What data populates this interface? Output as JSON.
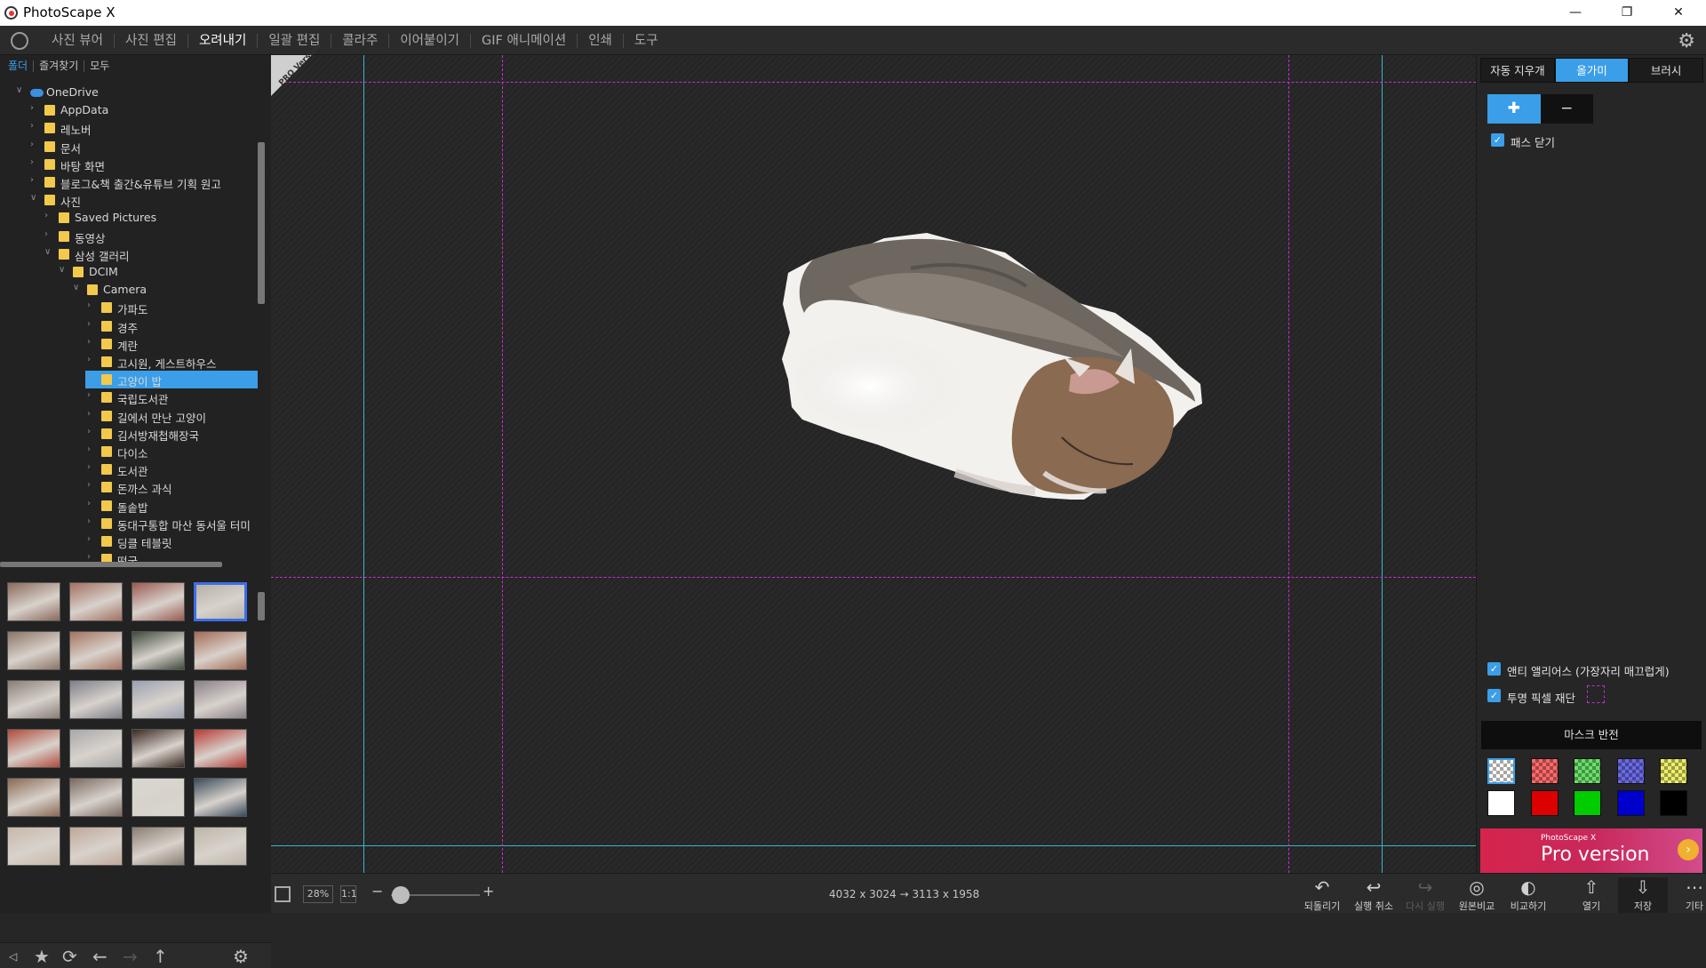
{
  "window": {
    "title": "PhotoScape X"
  },
  "menu": {
    "tabs": [
      "사진 뷰어",
      "사진 편집",
      "오려내기",
      "일괄 편집",
      "콜라주",
      "이어붙이기",
      "GIF 애니메이션",
      "인쇄",
      "도구"
    ],
    "active_tab": "오려내기"
  },
  "left_panel": {
    "tabs": [
      "폴더",
      "즐겨찾기",
      "모두"
    ],
    "tree": [
      {
        "label": "OneDrive",
        "depth": 0,
        "expanded": true,
        "icon": "cloud-icon"
      },
      {
        "label": "AppData",
        "depth": 1,
        "expanded": false
      },
      {
        "label": "레노버",
        "depth": 1,
        "expanded": false
      },
      {
        "label": "문서",
        "depth": 1,
        "expanded": false
      },
      {
        "label": "바탕 화면",
        "depth": 1,
        "expanded": false
      },
      {
        "label": "블로그&책 출간&유튜브 기획 원고",
        "depth": 1,
        "expanded": false
      },
      {
        "label": "사진",
        "depth": 1,
        "expanded": true
      },
      {
        "label": "Saved Pictures",
        "depth": 2,
        "expanded": false
      },
      {
        "label": "동영상",
        "depth": 2,
        "expanded": false
      },
      {
        "label": "삼성 갤러리",
        "depth": 2,
        "expanded": true
      },
      {
        "label": "DCIM",
        "depth": 3,
        "expanded": true
      },
      {
        "label": "Camera",
        "depth": 4,
        "expanded": true
      },
      {
        "label": "가파도",
        "depth": 5,
        "expanded": false
      },
      {
        "label": "경주",
        "depth": 5,
        "expanded": false
      },
      {
        "label": "계란",
        "depth": 5,
        "expanded": false
      },
      {
        "label": "고시원, 게스트하우스",
        "depth": 5,
        "expanded": false
      },
      {
        "label": "고양이 밥",
        "depth": 5,
        "expanded": false,
        "selected": true
      },
      {
        "label": "국립도서관",
        "depth": 5,
        "expanded": false
      },
      {
        "label": "길에서 만난 고양이",
        "depth": 5,
        "expanded": false
      },
      {
        "label": "김서방재첩해장국",
        "depth": 5,
        "expanded": false
      },
      {
        "label": "다이소",
        "depth": 5,
        "expanded": false
      },
      {
        "label": "도서관",
        "depth": 5,
        "expanded": false
      },
      {
        "label": "돈까스 과식",
        "depth": 5,
        "expanded": false
      },
      {
        "label": "돌솥밥",
        "depth": 5,
        "expanded": false
      },
      {
        "label": "동대구통합 마산 동서울 터미",
        "depth": 5,
        "expanded": false
      },
      {
        "label": "딩클 테블릿",
        "depth": 5,
        "expanded": false
      },
      {
        "label": "떡국",
        "depth": 5,
        "expanded": false
      }
    ],
    "thumbnail_colors": [
      [
        "#8a6a5a",
        "#a37060",
        "#9a5a50",
        "#b5b0a8"
      ],
      [
        "#8c7565",
        "#a5735e",
        "#3f4a3c",
        "#a56b55"
      ],
      [
        "#8a7d78",
        "#7d7f8a",
        "#9aa0b0",
        "#8a8088"
      ],
      [
        "#b04a3a",
        "#a8a8a8",
        "#3a2a22",
        "#b83a34"
      ],
      [
        "#8a6a55",
        "#7a6a60",
        "#d8d6d0",
        "#3a4a5a"
      ],
      [
        "#c8b8a8",
        "#c0a898",
        "#8a7e70",
        "#bcb6a8"
      ]
    ],
    "selected_thumbnail": "0-3"
  },
  "canvas": {
    "badge": "PRO Version"
  },
  "status": {
    "zoom": "28%",
    "zoom_1to1": "1:1",
    "zoom_minus": "−",
    "zoom_plus": "+",
    "zoom_level": 0.28,
    "dimensions": "4032 x 3024 → 3113 x 1958"
  },
  "bottom_actions": [
    {
      "label": "되돌리기",
      "icon": "revert-icon",
      "enabled": true
    },
    {
      "label": "실행 취소",
      "icon": "undo-icon",
      "enabled": true
    },
    {
      "label": "다시 실행",
      "icon": "redo-icon",
      "enabled": false
    },
    {
      "label": "원본비교",
      "icon": "compare-original-icon",
      "enabled": true
    },
    {
      "label": "비교하기",
      "icon": "compare-icon",
      "enabled": true
    },
    {
      "label": "열기",
      "icon": "open-icon",
      "enabled": true
    },
    {
      "label": "저장",
      "icon": "save-icon",
      "enabled": true
    },
    {
      "label": "기타",
      "icon": "more-icon",
      "enabled": true
    }
  ],
  "right_panel": {
    "mode_tabs": [
      "자동 지우개",
      "올가미",
      "브러시"
    ],
    "active_mode": "올가미",
    "close_path": {
      "label": "패스 닫기",
      "checked": true
    },
    "antialias": {
      "label": "앤티 앨리어스 (가장자리 매끄럽게)",
      "checked": true
    },
    "trim_transparent": {
      "label": "투명 픽셀 재단",
      "checked": true
    },
    "mask_invert": "마스크 반전",
    "swatches_row1": [
      "checker",
      "#ff6a6a",
      "#6ae06a",
      "#6a6ae6",
      "#eeee6a"
    ],
    "swatches_row2": [
      "#ffffff",
      "#dd0000",
      "#00cc00",
      "#0000cc",
      "#000000"
    ],
    "selected_swatch": "checker",
    "banner": {
      "small": "PhotoScape X",
      "big": "Pro version"
    }
  },
  "colors": {
    "accent": "#3b9ee8",
    "guide_cyan": "#35b7c9",
    "guide_magenta": "#c62ed0",
    "banner": "#d6244c"
  }
}
